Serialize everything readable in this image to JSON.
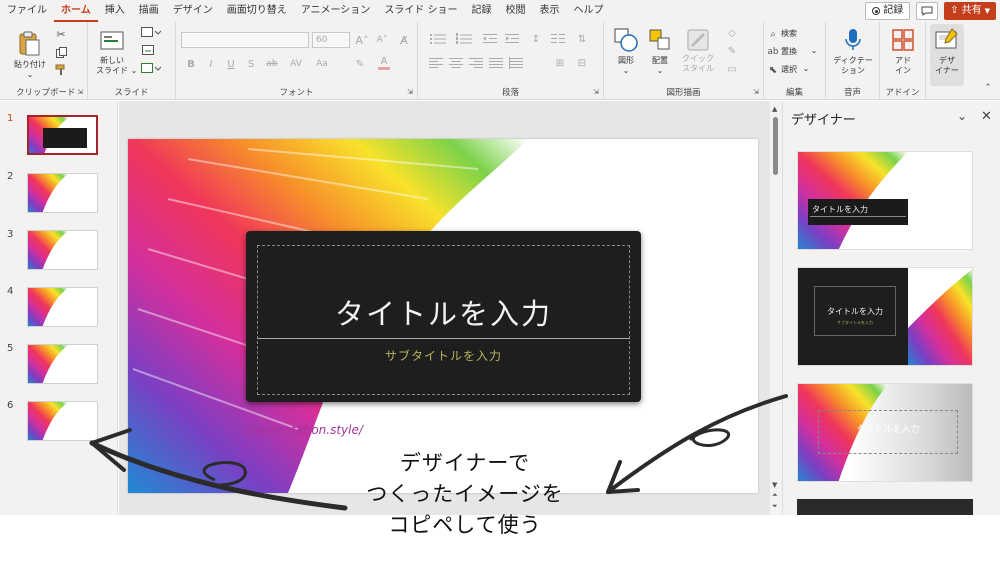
{
  "tabs": [
    "ファイル",
    "ホーム",
    "挿入",
    "描画",
    "デザイン",
    "画面切り替え",
    "アニメーション",
    "スライド ショー",
    "記録",
    "校閲",
    "表示",
    "ヘルプ"
  ],
  "active_tab": "ホーム",
  "record_label": "記録",
  "share_label": "共有",
  "ribbon": {
    "clipboard": {
      "paste_label": "貼り付け",
      "group_label": "クリップボード"
    },
    "slides": {
      "new_slide_label": "新しい\nスライド",
      "group_label": "スライド"
    },
    "font": {
      "font_name": "",
      "font_size": "60",
      "group_label": "フォント"
    },
    "paragraph": {
      "group_label": "段落"
    },
    "drawing": {
      "shapes_label": "図形",
      "arrange_label": "配置",
      "quick_style_label": "クイック\nスタイル",
      "group_label": "図形描画"
    },
    "editing": {
      "find_label": "検索",
      "replace_label": "置換",
      "select_label": "選択",
      "group_label": "編集"
    },
    "voice": {
      "dictate_label": "ディクテー\nション",
      "group_label": "音声"
    },
    "addins": {
      "addin_label": "アド\nイン",
      "group_label": "アドイン"
    },
    "designer": {
      "label": "デザ\nイナー"
    }
  },
  "slide_numbers": [
    "1",
    "2",
    "3",
    "4",
    "5",
    "6"
  ],
  "slide": {
    "title": "タイトルを入力",
    "subtitle": "サブタイトルを入力",
    "watermark": "/presentation.style/"
  },
  "designer_pane": {
    "title": "デザイナー",
    "cards": [
      {
        "title": "タイトルを入力"
      },
      {
        "title": "タイトルを入力",
        "subtitle": "サブタイトルを入力"
      },
      {
        "title": "タイトルを入力"
      }
    ]
  },
  "caption_lines": [
    "デザイナーで",
    "つくったイメージを",
    "コピペして使う"
  ],
  "colors": {
    "accent": "#c43e1c",
    "selected_thumb": "#a4262c",
    "subtitle": "#b8b25a",
    "watermark": "#a3359a"
  }
}
